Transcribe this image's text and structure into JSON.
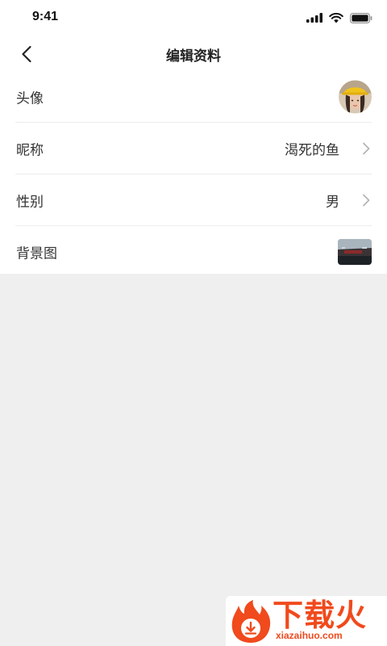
{
  "status_bar": {
    "time": "9:41",
    "icons": [
      "cellular-signal-icon",
      "wifi-icon",
      "battery-icon"
    ]
  },
  "header": {
    "back_icon": "chevron-left-icon",
    "title": "编辑资料"
  },
  "profile_items": [
    {
      "label": "头像",
      "value": "",
      "type": "avatar-image"
    },
    {
      "label": "昵称",
      "value": "渴死的鱼",
      "type": "text",
      "chevron": true
    },
    {
      "label": "性别",
      "value": "男",
      "type": "text",
      "chevron": true
    },
    {
      "label": "背景图",
      "value": "",
      "type": "background-image"
    }
  ],
  "watermark": {
    "brand": "下载火",
    "site": "xiazaihuo.com"
  },
  "colors": {
    "page_background": "#efefef",
    "card_background": "#ffffff",
    "divider": "#ececec",
    "chevron": "#b5b5b5",
    "watermark_accent": "#f04a1d"
  }
}
